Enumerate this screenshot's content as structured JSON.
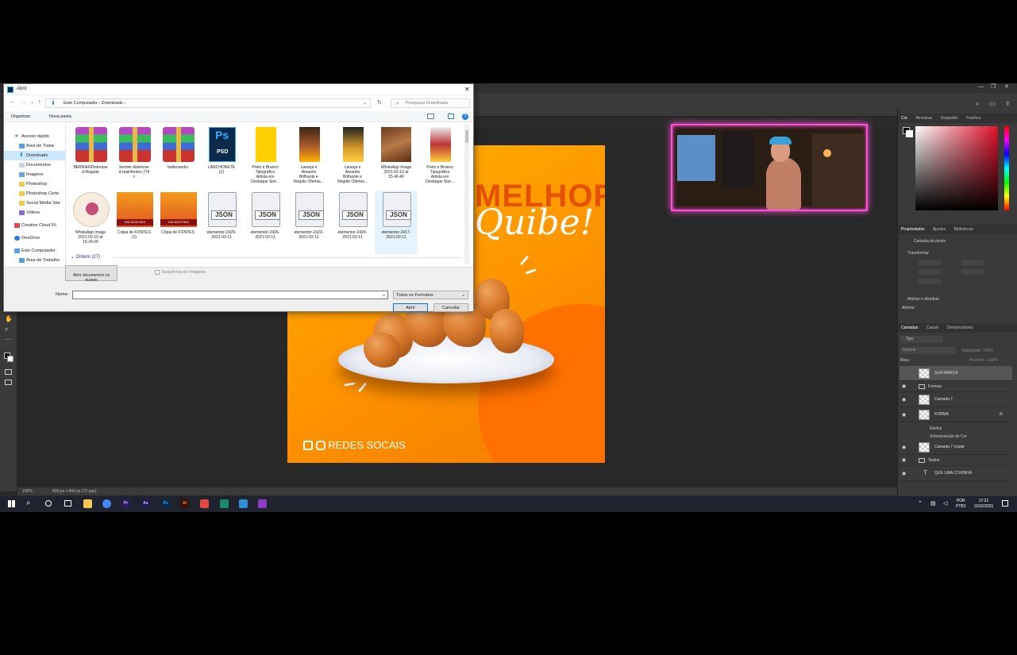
{
  "dialog": {
    "title": "Abrir",
    "breadcrumb": [
      "Este Computador",
      "Downloads"
    ],
    "search_placeholder": "Pesquisar Downloads",
    "cmd_organize": "Organizar",
    "cmd_new_folder": "Nova pasta",
    "nav": [
      "Acesso rápido",
      "Área de Traba",
      "Downloads",
      "Documentos",
      "Imagens",
      "Photoshop",
      "Photoshop Certo",
      "Social Media Stor",
      "Vídeos",
      "Creative Cloud Fil",
      "OneDrive",
      "Este Computador",
      "Área de Trabalho"
    ],
    "files_row1": [
      {
        "name": "BERNIERDistresse\nd-Regular",
        "icon": "rar-icon"
      },
      {
        "name": "bernier-distresse\nd-mainfontes.774\nc",
        "icon": "rar-icon"
      },
      {
        "name": "betterworks",
        "icon": "rar-icon"
      },
      {
        "name": "LANCHONETE\n(1)",
        "icon": "psd-icon",
        "icon_label": "Ps",
        "icon_sub": "PSD"
      },
      {
        "name": "Preto e Branco\nTipográfico\nArtista em\nDestaque Stor...",
        "icon": "yellow-image-icon"
      },
      {
        "name": "Laranja e\nAmarelo\nBrilhante e\nNegrito Ofertas...",
        "icon": "image-thumb-icon"
      },
      {
        "name": "Laranja e\nAmarelo\nBrilhante e\nNegrito Ofertas...",
        "icon": "image-thumb-icon"
      },
      {
        "name": "WhatsApp Image\n2021-02-10 at\n15.46.40",
        "icon": "image-thumb-icon"
      },
      {
        "name": "Preto e Branco\nTipográfico\nArtista em\nDestaque Stor...",
        "icon": "image-thumb-icon"
      }
    ],
    "files_row2": [
      {
        "name": "WhatsApp Image\n2021-02-10 at\n15.24.09",
        "icon": "logo-thumb-icon"
      },
      {
        "name": "Cópia de FONTES\n(1)",
        "icon": "poster-thumb-icon",
        "banner": "DIA DOS PAIS"
      },
      {
        "name": "Cópia de FONTES",
        "icon": "poster-thumb-icon",
        "banner": "DIA DOS PAIS"
      },
      {
        "name": "elementor-2429-\n2021-02-11",
        "icon": "json-icon",
        "icon_label": "JSON"
      },
      {
        "name": "elementor-2426-\n2021-02-11",
        "icon": "json-icon",
        "icon_label": "JSON"
      },
      {
        "name": "elementor-2423-\n2021-02-11",
        "icon": "json-icon",
        "icon_label": "JSON"
      },
      {
        "name": "elementor-2420-\n2021-02-11",
        "icon": "json-icon",
        "icon_label": "JSON"
      },
      {
        "name": "elementor-2417-\n2021-02-11",
        "icon": "json-icon",
        "icon_label": "JSON"
      }
    ],
    "group_label": "Ontem (27)",
    "tooltip": "Abrir documentos na\nnuvem",
    "sequence_label": "Sequência de Imagens",
    "name_label": "Nome:",
    "filter_value": "Todos os Formatos",
    "open_button": "Abrir",
    "cancel_button": "Cancelar"
  },
  "artboard": {
    "headline": "MELHOR",
    "script": "Quibe!",
    "social": "REDES SOCAIS"
  },
  "status": {
    "zoom": "100%",
    "size": "800 px x 800 px (72 ppp)"
  },
  "panels": {
    "color_tabs": [
      "Cor",
      "Amostras",
      "Degradês",
      "Padrões"
    ],
    "props_tabs": [
      "Propriedades",
      "Ajustes",
      "Bibliotecas"
    ],
    "props_layer": "Camada de pixels",
    "transform": "Transformar",
    "align": "Alinhar e distribuir",
    "align_sub": "Alinhar:",
    "layers_tabs": [
      "Camadas",
      "Canais",
      "Demarcadores"
    ],
    "filter_kind": "Tipo",
    "blend": "Normal",
    "opacity": "Opacidade: 100%",
    "lock": "Bloq.:",
    "fill": "Preench.: 100%",
    "layers": [
      {
        "name": "SUA MARCA",
        "kind": "pixel",
        "selected": true,
        "visible": false
      },
      {
        "name": "Formas",
        "kind": "group",
        "visible": true
      },
      {
        "name": "Camada 7",
        "kind": "pixel",
        "visible": true
      },
      {
        "name": "FORMA",
        "kind": "pixel",
        "visible": true,
        "fx": "fx"
      },
      {
        "name": "Efeitos",
        "kind": "effect",
        "visible": true
      },
      {
        "name": "Sobreposição de Cor",
        "kind": "effect",
        "visible": true
      },
      {
        "name": "Camada 7 copiar",
        "kind": "pixel",
        "visible": true
      },
      {
        "name": "Textos",
        "kind": "group",
        "visible": true
      },
      {
        "name": "QUE UMA COXINHA",
        "kind": "text",
        "visible": true
      }
    ]
  },
  "taskbar": {
    "lang": "POR",
    "layout": "PTB2",
    "time": "17:21",
    "date": "11/02/2021",
    "apps": [
      {
        "id": "file-explorer",
        "label": "",
        "color": "#f2c94c"
      },
      {
        "id": "chrome",
        "label": "",
        "color": "#4285f4"
      },
      {
        "id": "premiere",
        "label": "Pr",
        "color": "#2b1c5a"
      },
      {
        "id": "after-effects",
        "label": "Ae",
        "color": "#1f1a4d"
      },
      {
        "id": "photoshop",
        "label": "Ps",
        "color": "#0b2a4a"
      },
      {
        "id": "illustrator",
        "label": "Ai",
        "color": "#3a1200"
      },
      {
        "id": "record",
        "label": "",
        "color": "#e04a3a"
      },
      {
        "id": "app-green",
        "label": "",
        "color": "#1b8a6b"
      },
      {
        "id": "app-blue",
        "label": "",
        "color": "#2d8fd5"
      },
      {
        "id": "winrar",
        "label": "",
        "color": "#8e3cc4"
      }
    ]
  },
  "colors": {
    "accent": "#ff4fd8",
    "artboard_orange": "#ff9800",
    "ps_panel": "#3a3a3a"
  }
}
